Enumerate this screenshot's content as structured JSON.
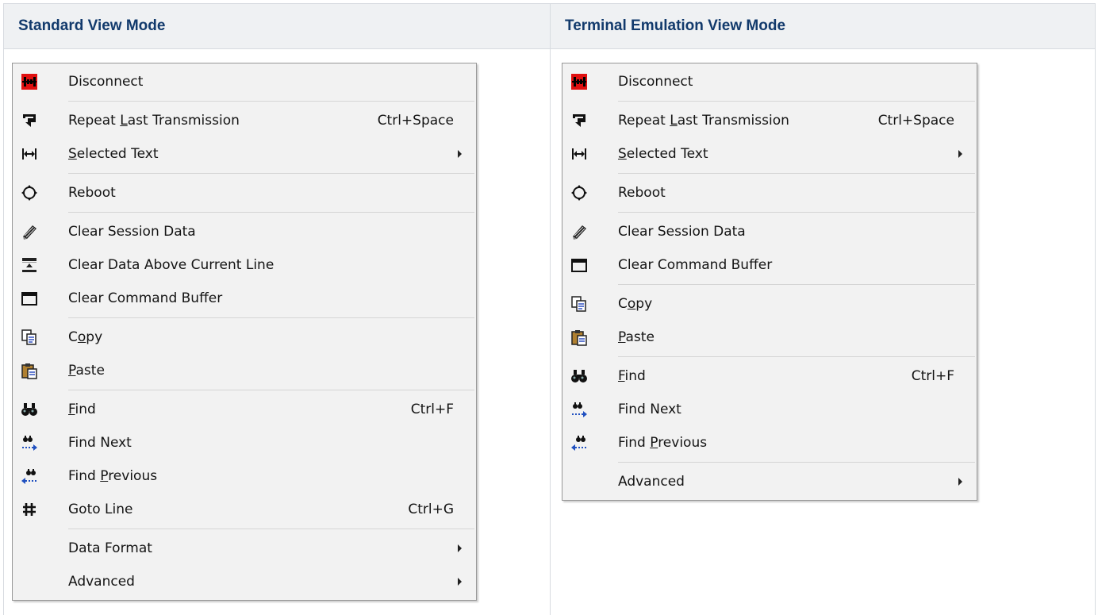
{
  "headers": {
    "standard": "Standard View Mode",
    "terminal": "Terminal Emulation View Mode"
  },
  "standard_menu": {
    "disconnect": "Disconnect",
    "repeat": {
      "pre": "Repeat ",
      "u": "L",
      "post": "ast Transmission",
      "shortcut": "Ctrl+Space"
    },
    "selected_text": {
      "pre": "",
      "u": "S",
      "post": "elected Text"
    },
    "reboot": "Reboot",
    "clear_session": "Clear Session Data",
    "clear_above": "Clear Data Above Current Line",
    "clear_buffer": "Clear Command Buffer",
    "copy": {
      "pre": "C",
      "u": "o",
      "post": "py"
    },
    "paste": {
      "pre": "",
      "u": "P",
      "post": "aste"
    },
    "find": {
      "pre": "",
      "u": "F",
      "post": "ind",
      "shortcut": "Ctrl+F"
    },
    "find_next": "Find Next",
    "find_previous": {
      "pre": "Find ",
      "u": "P",
      "post": "revious"
    },
    "goto_line": {
      "label": "Goto Line",
      "shortcut": "Ctrl+G"
    },
    "data_format": "Data Format",
    "advanced": "Advanced"
  },
  "terminal_menu": {
    "disconnect": "Disconnect",
    "repeat": {
      "pre": "Repeat ",
      "u": "L",
      "post": "ast Transmission",
      "shortcut": "Ctrl+Space"
    },
    "selected_text": {
      "pre": "",
      "u": "S",
      "post": "elected Text"
    },
    "reboot": "Reboot",
    "clear_session": "Clear Session Data",
    "clear_buffer": "Clear Command Buffer",
    "copy": {
      "pre": "C",
      "u": "o",
      "post": "py"
    },
    "paste": {
      "pre": "",
      "u": "P",
      "post": "aste"
    },
    "find": {
      "pre": "",
      "u": "F",
      "post": "ind",
      "shortcut": "Ctrl+F"
    },
    "find_next": "Find Next",
    "find_previous": {
      "pre": "Find ",
      "u": "P",
      "post": "revious"
    },
    "advanced": "Advanced"
  },
  "colors": {
    "header_bg": "#eff1f3",
    "header_text": "#123a6c",
    "menu_bg": "#f2f2f2",
    "disconnect_icon": "#e01010"
  }
}
